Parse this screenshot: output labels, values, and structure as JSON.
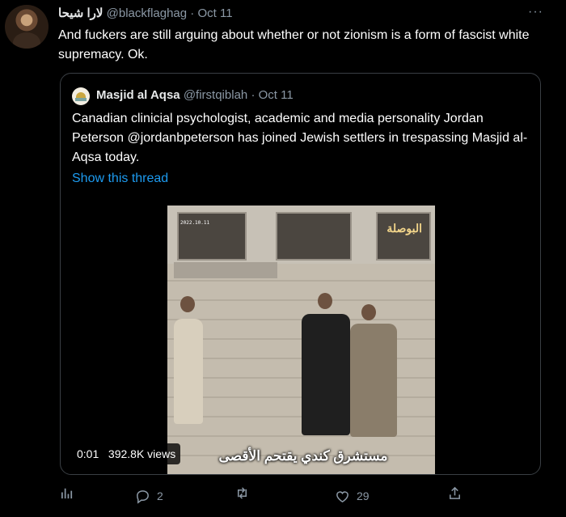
{
  "tweet": {
    "author_name": "لارا شيحا",
    "author_handle": "@blackflaghag",
    "separator": "·",
    "time": "Oct 11",
    "more": "···",
    "text": "And fuckers are still arguing about whether or not zionism is a form of fascist white supremacy. Ok."
  },
  "quote": {
    "author_name": "Masjid al Aqsa",
    "author_handle": "@firstqiblah",
    "separator": "·",
    "time": "Oct 11",
    "text": "Canadian clinicial psychologist, academic and media personality Jordan Peterson @jordanbpeterson has joined Jewish settlers in trespassing Masjid al-Aqsa today.",
    "show_thread": "Show this thread",
    "video": {
      "timestamp_overlay": "2022.10.11",
      "logo": "البوصلة",
      "caption": "مستشرق كندي يقتحم الأقصى",
      "time": "0:01",
      "views": "392.8K views"
    }
  },
  "actions": {
    "replies": "2",
    "likes": "29"
  },
  "icons": [
    "analytics-icon",
    "reply-icon",
    "retweet-icon",
    "like-icon",
    "share-icon",
    "more-icon"
  ],
  "colors": {
    "background": "#000000",
    "link": "#1d9bf0",
    "muted": "#8b98a5"
  }
}
